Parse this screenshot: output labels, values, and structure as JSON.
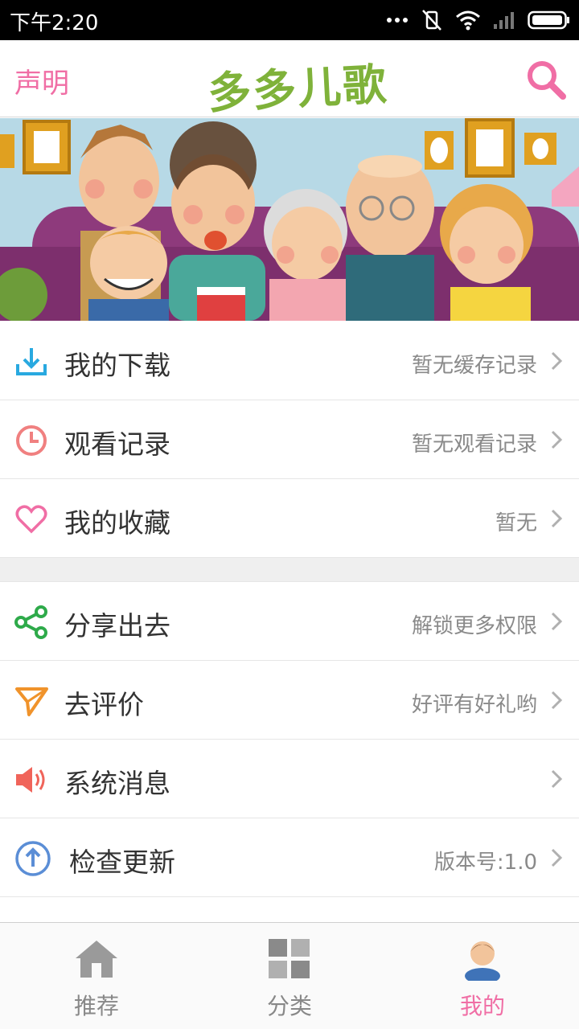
{
  "status_bar": {
    "time": "下午2:20"
  },
  "header": {
    "left_link": "声明",
    "logo": "多多儿歌",
    "search_icon": "search-icon"
  },
  "banner": {
    "description_icon": "family-banner-illustration"
  },
  "menu_group_1": [
    {
      "icon": "download-icon",
      "label": "我的下载",
      "value": "暂无缓存记录",
      "color": "#29a9e0"
    },
    {
      "icon": "clock-icon",
      "label": "观看记录",
      "value": "暂无观看记录",
      "color": "#f08080"
    },
    {
      "icon": "heart-icon",
      "label": "我的收藏",
      "value": "暂无",
      "color": "#f06ea5"
    }
  ],
  "menu_group_2": [
    {
      "icon": "share-icon",
      "label": "分享出去",
      "value": "解锁更多权限",
      "color": "#2eaa4a"
    },
    {
      "icon": "paper-plane-icon",
      "label": "去评价",
      "value": "好评有好礼哟",
      "color": "#f0932b"
    },
    {
      "icon": "speaker-icon",
      "label": "系统消息",
      "value": "",
      "color": "#f0645a"
    },
    {
      "icon": "upload-arrow-icon",
      "label": "检查更新",
      "value": "版本号:1.0",
      "color": "#5b8ed6"
    }
  ],
  "tabs": [
    {
      "label": "推荐",
      "icon": "home-icon",
      "active": false
    },
    {
      "label": "分类",
      "icon": "grid-icon",
      "active": false
    },
    {
      "label": "我的",
      "icon": "user-avatar-icon",
      "active": true
    }
  ],
  "colors": {
    "accent_pink": "#f06ea5",
    "logo_green": "#7fb23a"
  }
}
